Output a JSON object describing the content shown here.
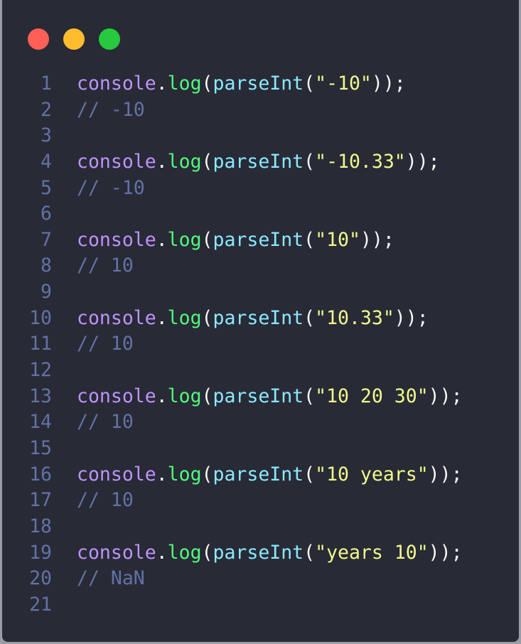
{
  "window_controls": {
    "close_color": "#ff5f56",
    "minimize_color": "#ffbd2e",
    "maximize_color": "#27c93f"
  },
  "lines": [
    {
      "n": "1",
      "kind": "call",
      "arg": "\"-10\""
    },
    {
      "n": "2",
      "kind": "comment",
      "text": "// -10"
    },
    {
      "n": "3",
      "kind": "blank"
    },
    {
      "n": "4",
      "kind": "call",
      "arg": "\"-10.33\""
    },
    {
      "n": "5",
      "kind": "comment",
      "text": "// -10"
    },
    {
      "n": "6",
      "kind": "blank"
    },
    {
      "n": "7",
      "kind": "call",
      "arg": "\"10\""
    },
    {
      "n": "8",
      "kind": "comment",
      "text": "// 10"
    },
    {
      "n": "9",
      "kind": "blank"
    },
    {
      "n": "10",
      "kind": "call",
      "arg": "\"10.33\""
    },
    {
      "n": "11",
      "kind": "comment",
      "text": "// 10"
    },
    {
      "n": "12",
      "kind": "blank"
    },
    {
      "n": "13",
      "kind": "call",
      "arg": "\"10 20 30\""
    },
    {
      "n": "14",
      "kind": "comment",
      "text": "// 10"
    },
    {
      "n": "15",
      "kind": "blank"
    },
    {
      "n": "16",
      "kind": "call",
      "arg": "\"10 years\""
    },
    {
      "n": "17",
      "kind": "comment",
      "text": "// 10"
    },
    {
      "n": "18",
      "kind": "blank"
    },
    {
      "n": "19",
      "kind": "call",
      "arg": "\"years 10\""
    },
    {
      "n": "20",
      "kind": "comment",
      "text": "// NaN"
    },
    {
      "n": "21",
      "kind": "blank"
    }
  ],
  "tokens": {
    "obj": "console",
    "dot": ".",
    "method": "log",
    "open": "(",
    "fn": "parseInt",
    "close": "));"
  }
}
